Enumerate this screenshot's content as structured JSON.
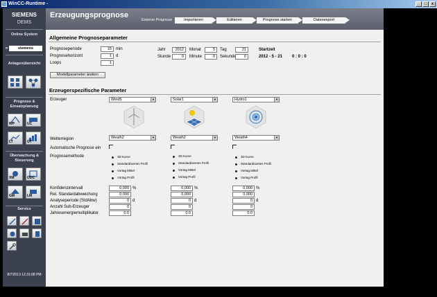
{
  "window": {
    "title": "WinCC-Runtime -",
    "min": "_",
    "max": "□",
    "close": "x"
  },
  "sidebar": {
    "brand": "SIEMENS",
    "product": "DEMS",
    "online_label": "Online System",
    "user": "siemens",
    "sections": [
      {
        "title": "Anlagenübersicht"
      },
      {
        "title": "Prognose & Einsatzplanung",
        "buttons": [
          "WP",
          "UC",
          "LT",
          "GT"
        ]
      },
      {
        "title": "Überwachung & Steuerung",
        "buttons": [
          "XM",
          "ODC",
          "GM",
          "LM"
        ]
      },
      {
        "title": "Service"
      }
    ],
    "timestamp": "8/7/2013 12:31:08 PM"
  },
  "header": {
    "title": "Erzeugungsprognose",
    "workflow_label": "Externe Prognose",
    "steps": [
      "Importieren",
      "Editieren",
      "Prognose starten",
      "Datenexport"
    ]
  },
  "general": {
    "title": "Allgemeine Prognoseparameter",
    "periode": {
      "label": "Prognoseperiode",
      "value": "15",
      "unit": "min"
    },
    "horizont": {
      "label": "Prognosehorizont",
      "value": "1",
      "unit": "d"
    },
    "loops": {
      "label": "Loops",
      "value": "1"
    },
    "jahr": {
      "label": "Jahr",
      "value": "2012"
    },
    "monat": {
      "label": "Monat",
      "value": "5"
    },
    "tag": {
      "label": "Tag",
      "value": "21"
    },
    "stunde": {
      "label": "Stunde",
      "value": "0"
    },
    "minute": {
      "label": "Minute",
      "value": "0"
    },
    "sekunde": {
      "label": "Sekunde",
      "value": "0"
    },
    "startzeit_label": "Startzeit",
    "startzeit_date": "2012 - 5 - 21",
    "startzeit_time": "0 : 0 : 0",
    "modell_button": "Modellparameter ändern"
  },
  "specific": {
    "title": "Erzeugerspezifische Parameter",
    "labels": {
      "erzeuger": "Erzeuger",
      "wetterregion": "Wetterregion",
      "auto": "Automatische Prognose ein",
      "methode": "Prognosemethode",
      "konfidenz": "Konfidenzintervall",
      "rel": "Rel. Standardabweichung",
      "analyse": "Analyseperiode (StdAbw)",
      "anzahl": "Anzahl Sub-Erzeuger",
      "jahres": "Jahresenergiemultiplikator"
    },
    "methods": [
      "3D Kurve",
      "Standardisiertes Profil",
      "Vortag Mittel",
      "Vortag Profil"
    ],
    "columns": [
      {
        "erzeuger": "Wind5",
        "wetter": "Weath2",
        "konfidenz": "0,000",
        "konf_unit": "%",
        "rel": "0,000",
        "analyse": "0",
        "analyse_unit": "d",
        "anzahl": "0",
        "jahres": "0.0",
        "icon": "wind-turbine-icon"
      },
      {
        "erzeuger": "Solar1",
        "wetter": "Weath2",
        "konfidenz": "0,000",
        "konf_unit": "%",
        "rel": "0,000",
        "analyse": "0",
        "analyse_unit": "d",
        "anzahl": "0",
        "jahres": "0.0",
        "icon": "solar-panel-icon"
      },
      {
        "erzeuger": "Hydro1",
        "wetter": "Weath4",
        "konfidenz": "0,000",
        "konf_unit": "%",
        "rel": "0,000",
        "analyse": "0",
        "analyse_unit": "d",
        "anzahl": "0",
        "jahres": "0.0",
        "icon": "hydro-turbine-icon"
      }
    ]
  },
  "colors": {
    "sidebar": "#3c4150",
    "header": "#6a6e7a",
    "background": "#f0f0f0"
  }
}
